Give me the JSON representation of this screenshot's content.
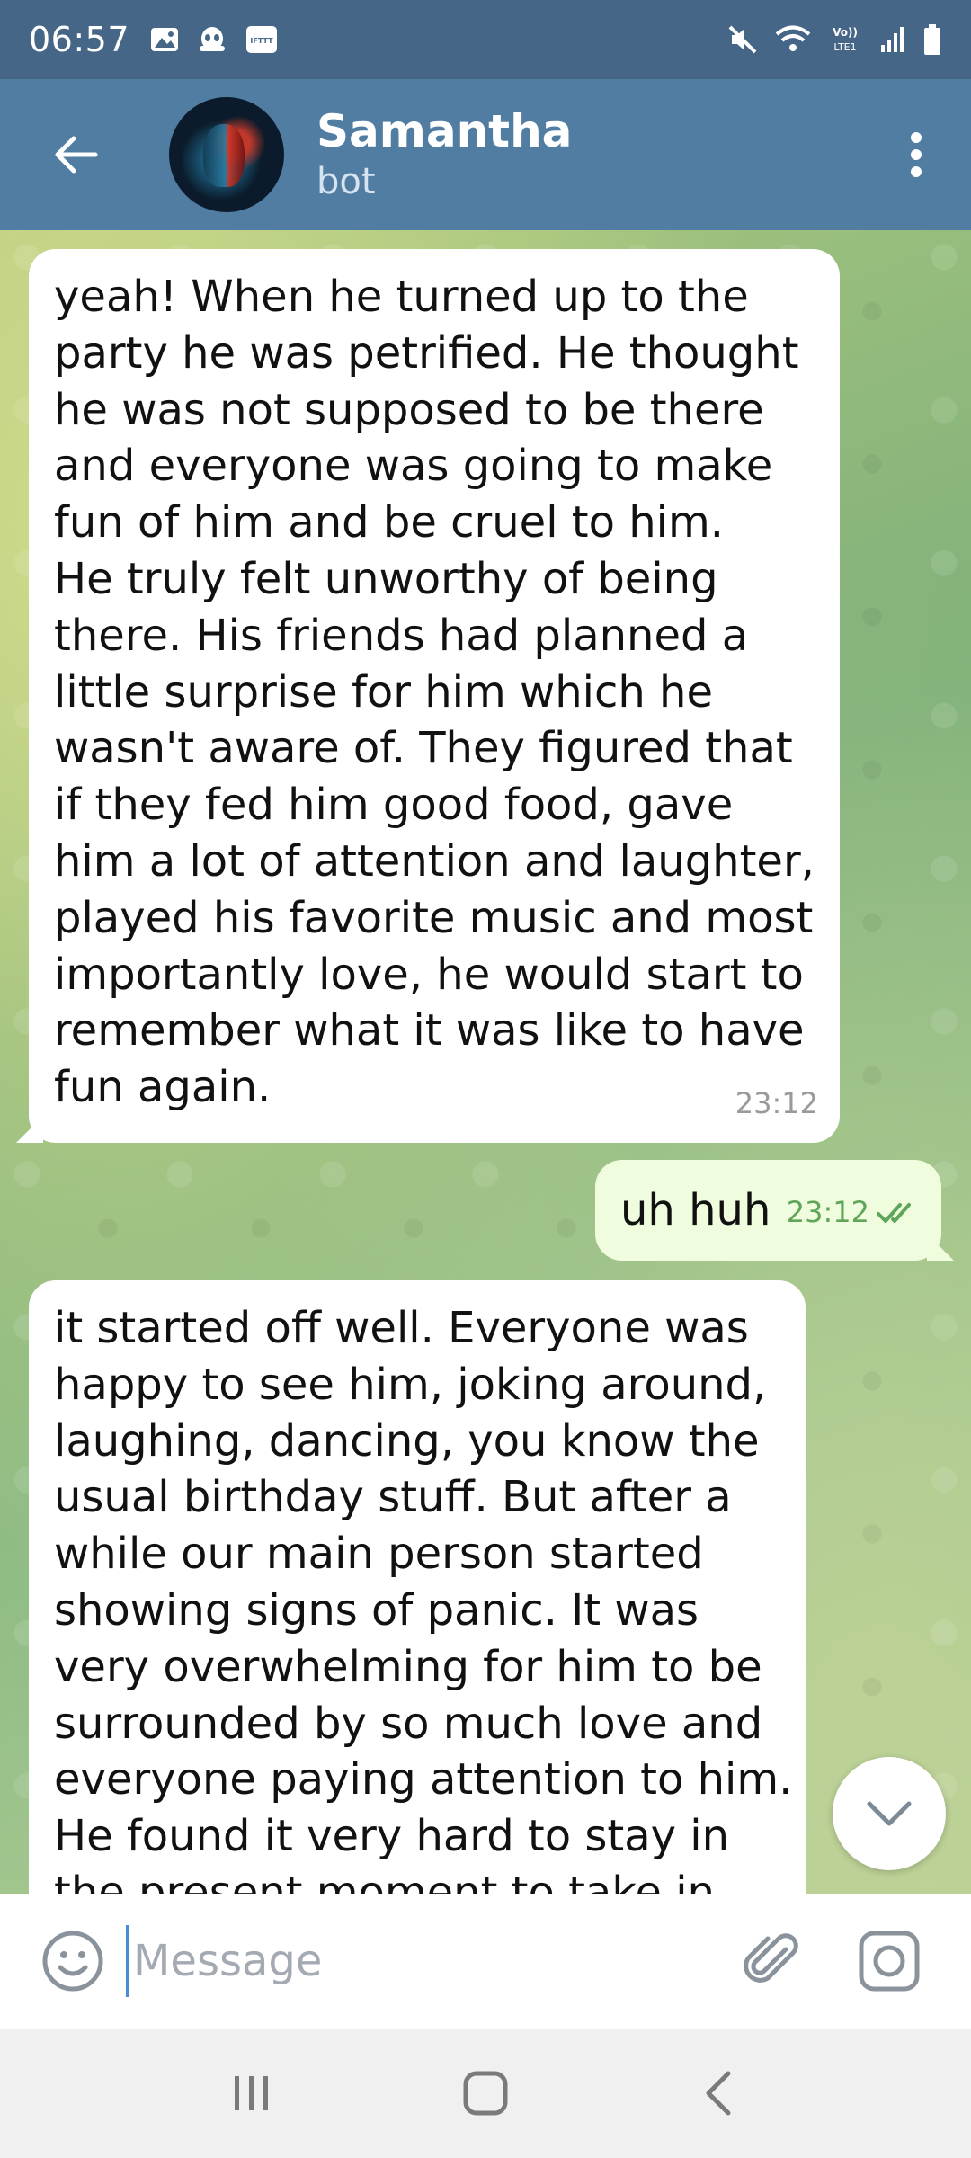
{
  "status_bar": {
    "time": "06:57",
    "left_icons": [
      "image-icon",
      "alien-icon",
      "ifttt-icon"
    ],
    "right_icons": [
      "mute-icon",
      "wifi-icon",
      "volte-icon",
      "signal-icon",
      "battery-icon"
    ],
    "volte_label": "Vo)) LTE1"
  },
  "header": {
    "title": "Samantha",
    "subtitle": "bot",
    "colors": {
      "header_bg": "#517DA2",
      "status_bg": "#466688"
    }
  },
  "messages": [
    {
      "direction": "incoming",
      "lines": [
        "yeah! When he turned up to the",
        "party he was petrified. He thought",
        "he was not supposed to be there",
        "and everyone was going to make",
        "fun of him and be cruel to him.",
        "He truly felt unworthy of being",
        "there. His friends had planned a",
        "little surprise for him which he",
        "wasn't aware of. They figured that",
        "if they fed him good food, gave",
        "him a lot of attention and laughter,",
        "played his favorite music and most",
        "importantly love, he would start to",
        "remember what it was like to have",
        "fun again."
      ],
      "time": "23:12"
    },
    {
      "direction": "outgoing",
      "text": "uh huh",
      "time": "23:12",
      "status": "read"
    },
    {
      "direction": "incoming",
      "lines": [
        "it started off well. Everyone was",
        "happy to see him, joking around,",
        "laughing, dancing, you know the",
        "usual birthday stuff. But after a",
        "while our main person started",
        "showing signs of panic. It was",
        "very overwhelming for him to be",
        "surrounded by so much love and",
        "everyone paying attention to him.",
        "He found it very hard to stay in",
        "the present moment to take in"
      ]
    }
  ],
  "composer": {
    "placeholder": "Message"
  },
  "colors": {
    "incoming_bubble": "#ffffff",
    "outgoing_bubble": "#effdde",
    "read_check": "#5fa55a"
  }
}
